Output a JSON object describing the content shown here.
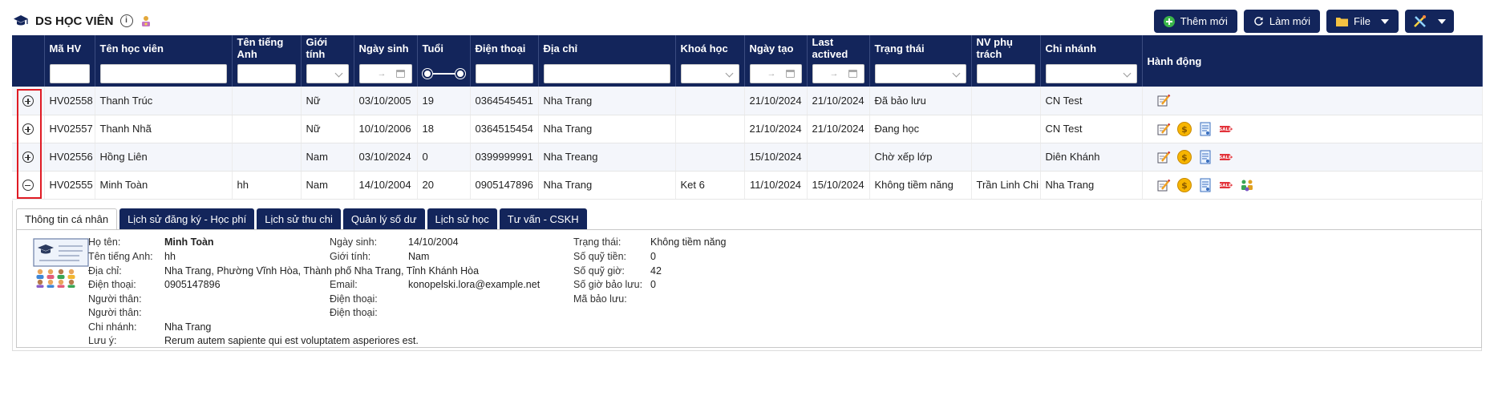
{
  "page": {
    "title": "DS HỌC VIÊN"
  },
  "toolbar": {
    "add_label": "Thêm mới",
    "refresh_label": "Làm mới",
    "file_label": "File"
  },
  "table": {
    "headers": [
      "Mã HV",
      "Tên học viên",
      "Tên tiếng Anh",
      "Giới tính",
      "Ngày sinh",
      "Tuổi",
      "Điện thoại",
      "Địa chỉ",
      "Khoá học",
      "Ngày tạo",
      "Last actived",
      "Trạng thái",
      "NV phụ trách",
      "Chi nhánh",
      "Hành động"
    ],
    "rows": [
      {
        "expanded": false,
        "code": "HV02558",
        "name": "Thanh Trúc",
        "english_name": "",
        "gender": "Nữ",
        "dob": "03/10/2005",
        "age": "19",
        "phone": "0364545451",
        "address": "Nha Trang",
        "course": "",
        "created": "21/10/2024",
        "last_active": "21/10/2024",
        "status": "Đã bảo lưu",
        "staff": "",
        "branch": "CN Test"
      },
      {
        "expanded": false,
        "code": "HV02557",
        "name": "Thanh Nhã",
        "english_name": "",
        "gender": "Nữ",
        "dob": "10/10/2006",
        "age": "18",
        "phone": "0364515454",
        "address": "Nha Trang",
        "course": "",
        "created": "21/10/2024",
        "last_active": "21/10/2024",
        "status": "Đang học",
        "staff": "",
        "branch": "CN Test"
      },
      {
        "expanded": false,
        "code": "HV02556",
        "name": "Hồng Liên",
        "english_name": "",
        "gender": "Nam",
        "dob": "03/10/2024",
        "age": "0",
        "phone": "0399999991",
        "address": "Nha Treang",
        "course": "",
        "created": "15/10/2024",
        "last_active": "",
        "status": "Chờ xếp lớp",
        "staff": "",
        "branch": "Diên Khánh"
      },
      {
        "expanded": true,
        "code": "HV02555",
        "name": "Minh Toàn",
        "english_name": "hh",
        "gender": "Nam",
        "dob": "14/10/2004",
        "age": "20",
        "phone": "0905147896",
        "address": "Nha Trang",
        "course": "Ket 6",
        "created": "11/10/2024",
        "last_active": "15/10/2024",
        "status": "Không tiềm năng",
        "staff": "Trần Linh Chi",
        "branch": "Nha Trang"
      }
    ]
  },
  "detail": {
    "tabs": [
      "Thông tin cá nhân",
      "Lịch sử đăng ký - Học phí",
      "Lịch sử thu chi",
      "Quản lý số dư",
      "Lịch sử học",
      "Tư vấn - CSKH"
    ],
    "labels": {
      "full_name": "Họ tên:",
      "english_name": "Tên tiếng Anh:",
      "address": "Địa chỉ:",
      "phone": "Điện thoại:",
      "relative1": "Người thân:",
      "relative2": "Người thân:",
      "branch": "Chi nhánh:",
      "note": "Lưu ý:",
      "dob": "Ngày sinh:",
      "gender": "Giới tính:",
      "email": "Email:",
      "rel_phone1": "Điện thoại:",
      "rel_phone2": "Điện thoại:",
      "status": "Trạng thái:",
      "fund_money": "Số quỹ tiền:",
      "fund_hours": "Số quỹ giờ:",
      "reserved_hours": "Số giờ bảo lưu:",
      "reserve_code": "Mã bảo lưu:"
    },
    "values": {
      "full_name": "Minh Toàn",
      "english_name": "hh",
      "address": "Nha Trang, Phường Vĩnh Hòa, Thành phố Nha Trang, Tỉnh Khánh Hòa",
      "phone": "0905147896",
      "branch": "Nha Trang",
      "note": "Rerum autem sapiente qui est voluptatem asperiores est.",
      "dob": "14/10/2004",
      "gender": "Nam",
      "email": "konopelski.lora@example.net",
      "status": "Không tiềm năng",
      "fund_money": "0",
      "fund_hours": "42",
      "reserved_hours": "0"
    }
  }
}
